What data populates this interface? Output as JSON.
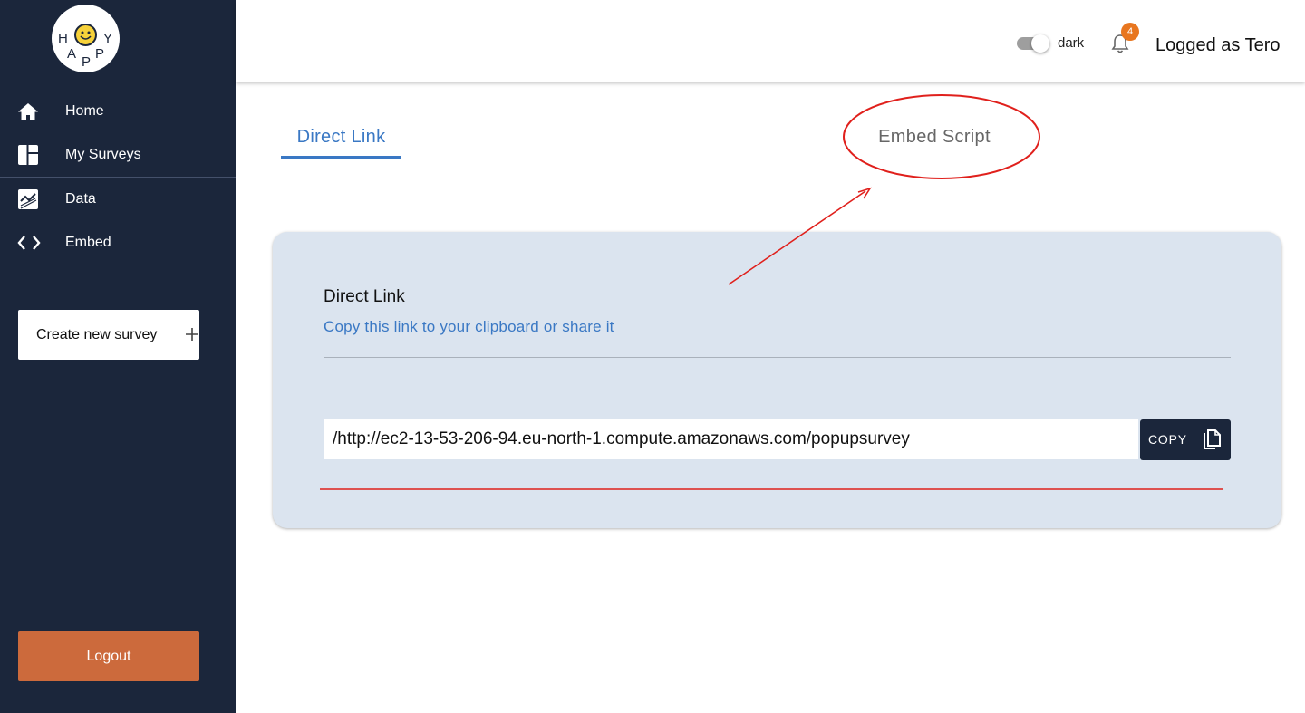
{
  "logo": {
    "letters": [
      "H",
      "Y",
      "A",
      "P",
      "P"
    ]
  },
  "sidebar": {
    "items": [
      {
        "label": "Home",
        "icon": "home-icon"
      },
      {
        "label": "My Surveys",
        "icon": "dashboard-icon"
      },
      {
        "label": "Data",
        "icon": "chart-icon"
      },
      {
        "label": "Embed",
        "icon": "code-icon"
      }
    ],
    "create_label": "Create new survey",
    "logout_label": "Logout"
  },
  "header": {
    "theme_toggle_label": "dark",
    "notification_count": "4",
    "user_label": "Logged as Tero"
  },
  "tabs": [
    {
      "label": "Direct Link",
      "active": true
    },
    {
      "label": "Embed Script",
      "active": false
    }
  ],
  "card": {
    "title": "Direct Link",
    "subtitle": "Copy this link to your clipboard or share it",
    "link_value": "/http://ec2-13-53-206-94.eu-north-1.compute.amazonaws.com/popupsurvey",
    "copy_label": "COPY"
  },
  "colors": {
    "sidebar_bg": "#1b263b",
    "accent_blue": "#3a78c4",
    "logout_orange": "#cc6a3c",
    "card_bg": "#dbe4ef",
    "badge_orange": "#e8761f",
    "annotation_red": "#e0201c"
  }
}
